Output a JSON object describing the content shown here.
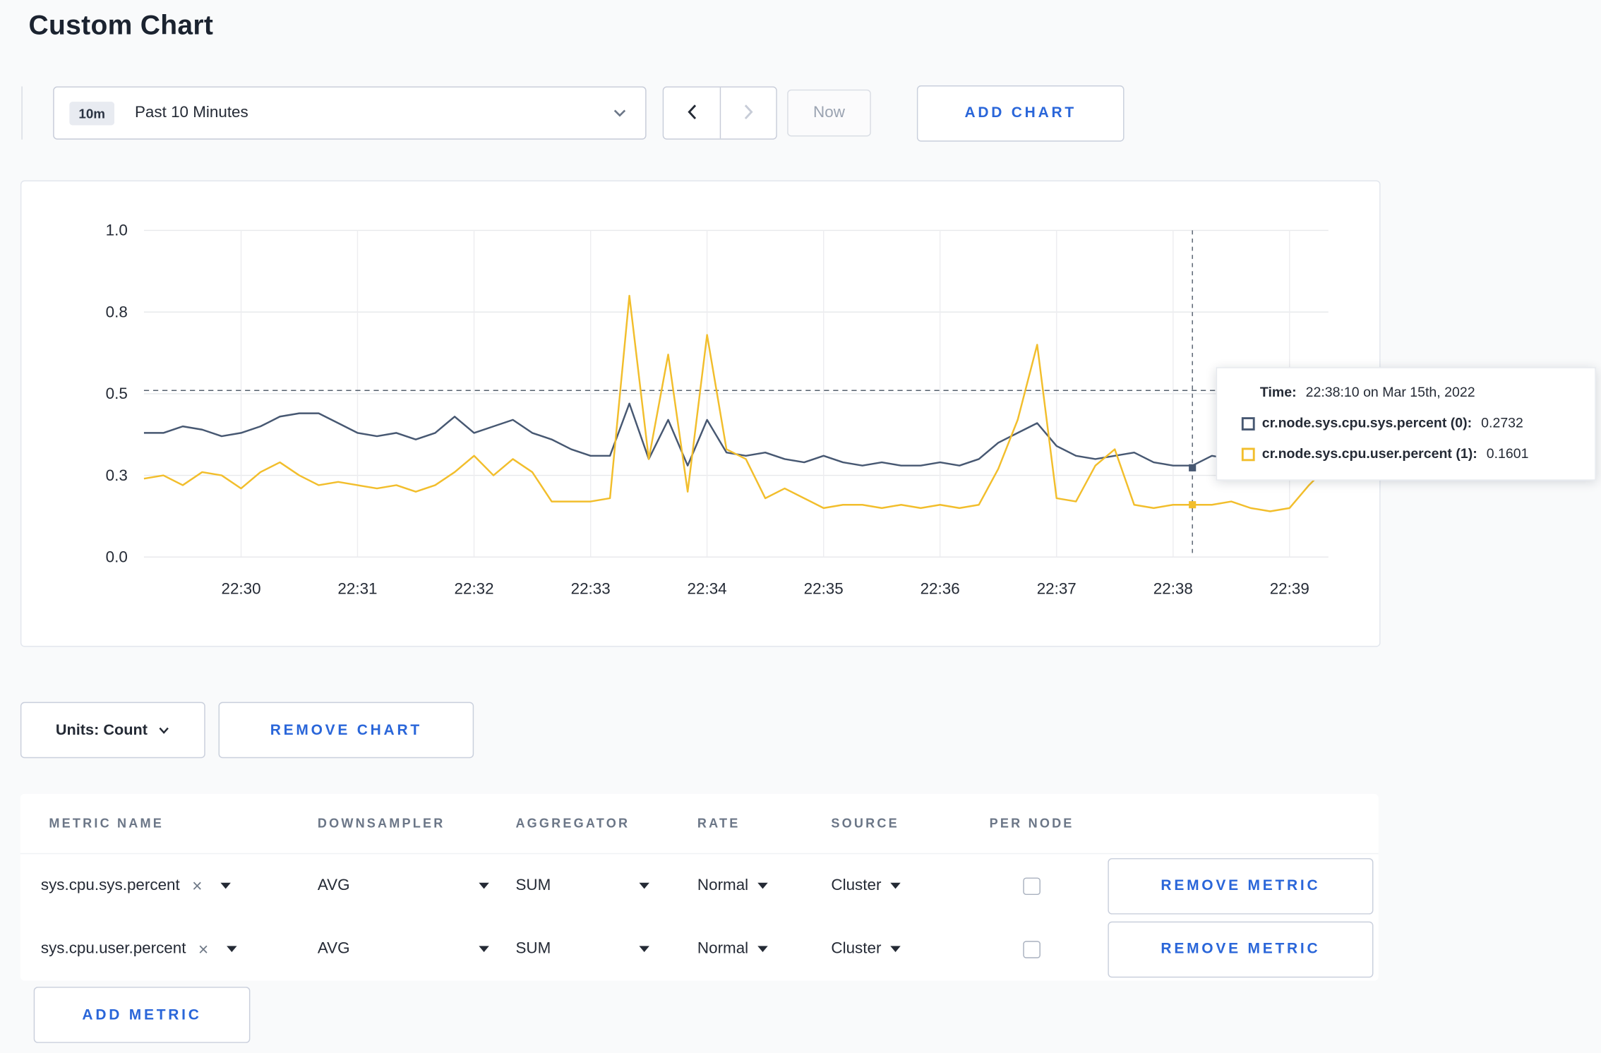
{
  "page": {
    "title": "Custom Chart"
  },
  "toolbar": {
    "time_window_badge": "10m",
    "time_window_label": "Past 10 Minutes",
    "now_label": "Now",
    "add_chart_label": "ADD CHART"
  },
  "chart_controls": {
    "units_label": "Units: Count",
    "remove_chart_label": "REMOVE CHART",
    "add_metric_label": "ADD METRIC"
  },
  "tooltip": {
    "time_label": "Time:",
    "time_value": "22:38:10 on Mar 15th, 2022",
    "series": [
      {
        "label": "cr.node.sys.cpu.sys.percent (0):",
        "value": "0.2732"
      },
      {
        "label": "cr.node.sys.cpu.user.percent (1):",
        "value": "0.1601"
      }
    ]
  },
  "metrics_table": {
    "headers": [
      "METRIC NAME",
      "DOWNSAMPLER",
      "AGGREGATOR",
      "RATE",
      "SOURCE",
      "PER NODE"
    ],
    "rows": [
      {
        "metric": "sys.cpu.sys.percent",
        "downsampler": "AVG",
        "aggregator": "SUM",
        "rate": "Normal",
        "source": "Cluster",
        "per_node": false,
        "remove_label": "REMOVE METRIC"
      },
      {
        "metric": "sys.cpu.user.percent",
        "downsampler": "AVG",
        "aggregator": "SUM",
        "rate": "Normal",
        "source": "Cluster",
        "per_node": false,
        "remove_label": "REMOVE METRIC"
      }
    ]
  },
  "chart_data": {
    "type": "line",
    "title": "",
    "xlabel": "",
    "ylabel": "",
    "ylim": [
      0,
      1
    ],
    "grid": true,
    "x_ticks": [
      "22:30",
      "22:31",
      "22:32",
      "22:33",
      "22:34",
      "22:35",
      "22:36",
      "22:37",
      "22:38",
      "22:39"
    ],
    "x_tick_fractions": [
      0.082,
      0.1803,
      0.2787,
      0.3771,
      0.4754,
      0.5738,
      0.6721,
      0.7705,
      0.8689,
      0.9672
    ],
    "y_tick_values": [
      0,
      0.25,
      0.5,
      0.75,
      1
    ],
    "y_tick_labels": [
      "0.0",
      "0.3",
      "0.5",
      "0.8",
      "1.0"
    ],
    "x_range": "22:29:10 to 22:39:20",
    "point_interval_seconds": 10,
    "series": [
      {
        "name": "cr.node.sys.cpu.sys.percent",
        "color": "#475872",
        "values": [
          0.38,
          0.38,
          0.4,
          0.39,
          0.37,
          0.38,
          0.4,
          0.43,
          0.44,
          0.44,
          0.41,
          0.38,
          0.37,
          0.38,
          0.36,
          0.38,
          0.43,
          0.38,
          0.4,
          0.42,
          0.38,
          0.36,
          0.33,
          0.31,
          0.31,
          0.47,
          0.3,
          0.42,
          0.28,
          0.42,
          0.32,
          0.31,
          0.32,
          0.3,
          0.29,
          0.31,
          0.29,
          0.28,
          0.29,
          0.28,
          0.28,
          0.29,
          0.28,
          0.3,
          0.35,
          0.38,
          0.41,
          0.34,
          0.31,
          0.3,
          0.31,
          0.32,
          0.29,
          0.28,
          0.28,
          0.31,
          0.3,
          0.31,
          0.3,
          0.3,
          0.31,
          0.29
        ]
      },
      {
        "name": "cr.node.sys.cpu.user.percent",
        "color": "#f2be2c",
        "values": [
          0.24,
          0.25,
          0.22,
          0.26,
          0.25,
          0.21,
          0.26,
          0.29,
          0.25,
          0.22,
          0.23,
          0.22,
          0.21,
          0.22,
          0.2,
          0.22,
          0.26,
          0.31,
          0.25,
          0.3,
          0.26,
          0.17,
          0.17,
          0.17,
          0.18,
          0.8,
          0.3,
          0.62,
          0.2,
          0.68,
          0.33,
          0.3,
          0.18,
          0.21,
          0.18,
          0.15,
          0.16,
          0.16,
          0.15,
          0.16,
          0.15,
          0.16,
          0.15,
          0.16,
          0.27,
          0.42,
          0.65,
          0.18,
          0.17,
          0.28,
          0.33,
          0.16,
          0.15,
          0.16,
          0.16,
          0.16,
          0.17,
          0.15,
          0.14,
          0.15,
          0.22,
          0.28
        ]
      }
    ],
    "crosshair": {
      "time": "22:38:10 on Mar 15th, 2022",
      "x_fraction": 0.8852,
      "hline_value": 0.51,
      "points": [
        0.2732,
        0.1601
      ]
    }
  }
}
